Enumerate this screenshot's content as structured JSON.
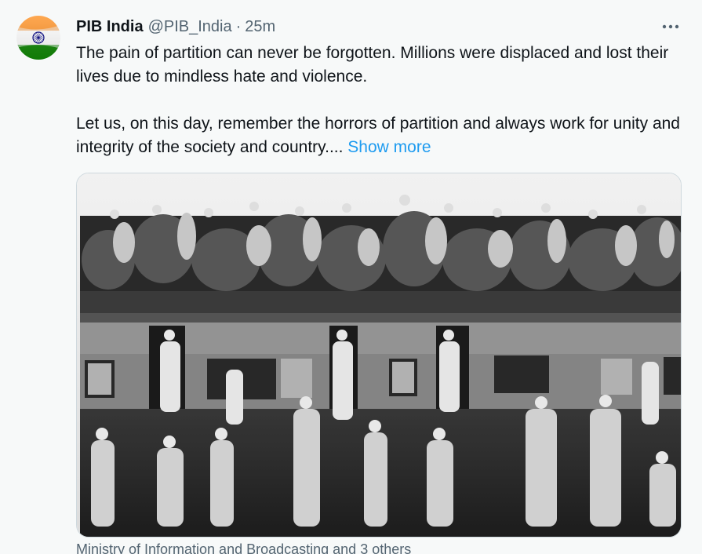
{
  "author": {
    "display_name": "PIB India",
    "handle": "@PIB_India",
    "separator": "·",
    "time": "25m",
    "avatar_icon": "india-flag-icon"
  },
  "menu_icon": "more-options-icon",
  "tweet": {
    "paragraph_1": "The pain of partition can never be forgotten. Millions were displaced  and lost their lives due to mindless hate and violence.",
    "paragraph_2": "Let us, on this day, remember the horrors of partition and always work for unity and integrity of the society and country....",
    "show_more": "Show more"
  },
  "media": {
    "description_icon": "partition-train-photo"
  },
  "credit": "Ministry of Information and Broadcasting and 3 others",
  "colors": {
    "link": "#1d9bf0",
    "text": "#0f1419",
    "muted": "#536471",
    "saffron": "#ff9933",
    "green": "#138808",
    "navy": "#000080"
  }
}
